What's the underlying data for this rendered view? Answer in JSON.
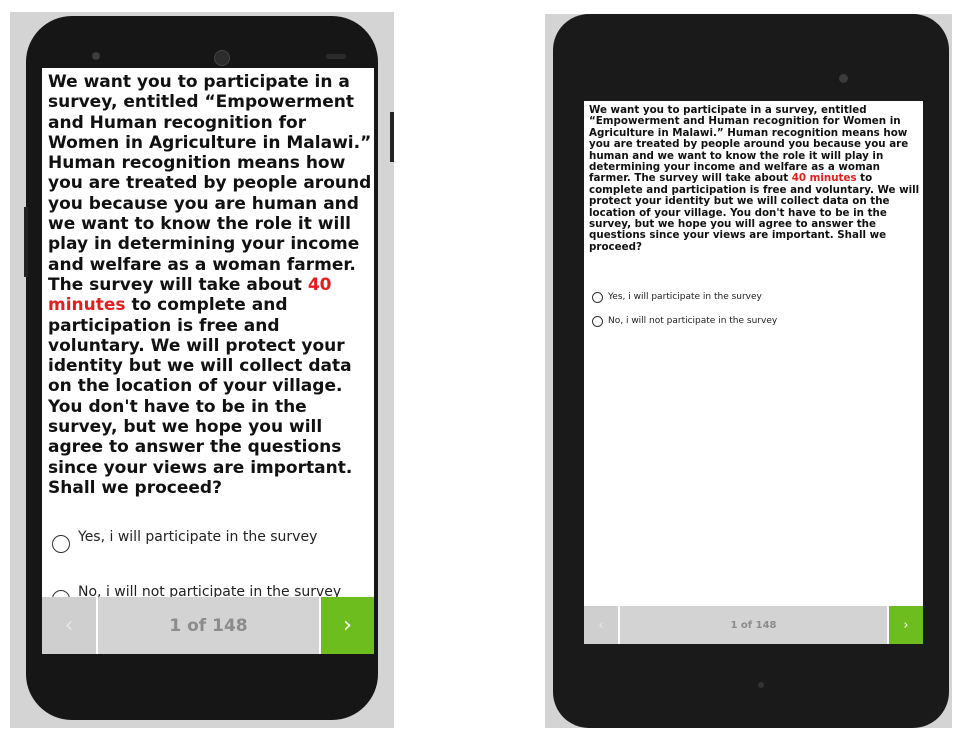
{
  "survey": {
    "question_before": "We want you to participate in a survey, entitled “Empowerment and  Human recognition for Women in Agriculture in Malawi.” Human recognition means how you are treated by people around you because you are human and we want to know the role it will play in determining your income and welfare as a woman farmer. The survey will take about ",
    "question_highlight": "40 minutes",
    "question_after": " to complete and participation is free and voluntary. We will protect your identity but we will collect data on the location of your village. You don't have to be in the survey, but we hope you will agree to answer the questions since your views are important. Shall we proceed?",
    "option_yes": "Yes, i will participate in the survey",
    "option_no": "No, i will not participate in the survey",
    "prev_icon": "‹",
    "next_icon": "›",
    "page_indicator": "1 of 148"
  },
  "colors": {
    "highlight": "#e41e1e",
    "next_button": "#6ebd1f",
    "nav_bar": "#d3d3d3"
  },
  "icons": {
    "prev": "chevron-left-icon",
    "next": "chevron-right-icon",
    "radio": "radio-unchecked-icon"
  }
}
